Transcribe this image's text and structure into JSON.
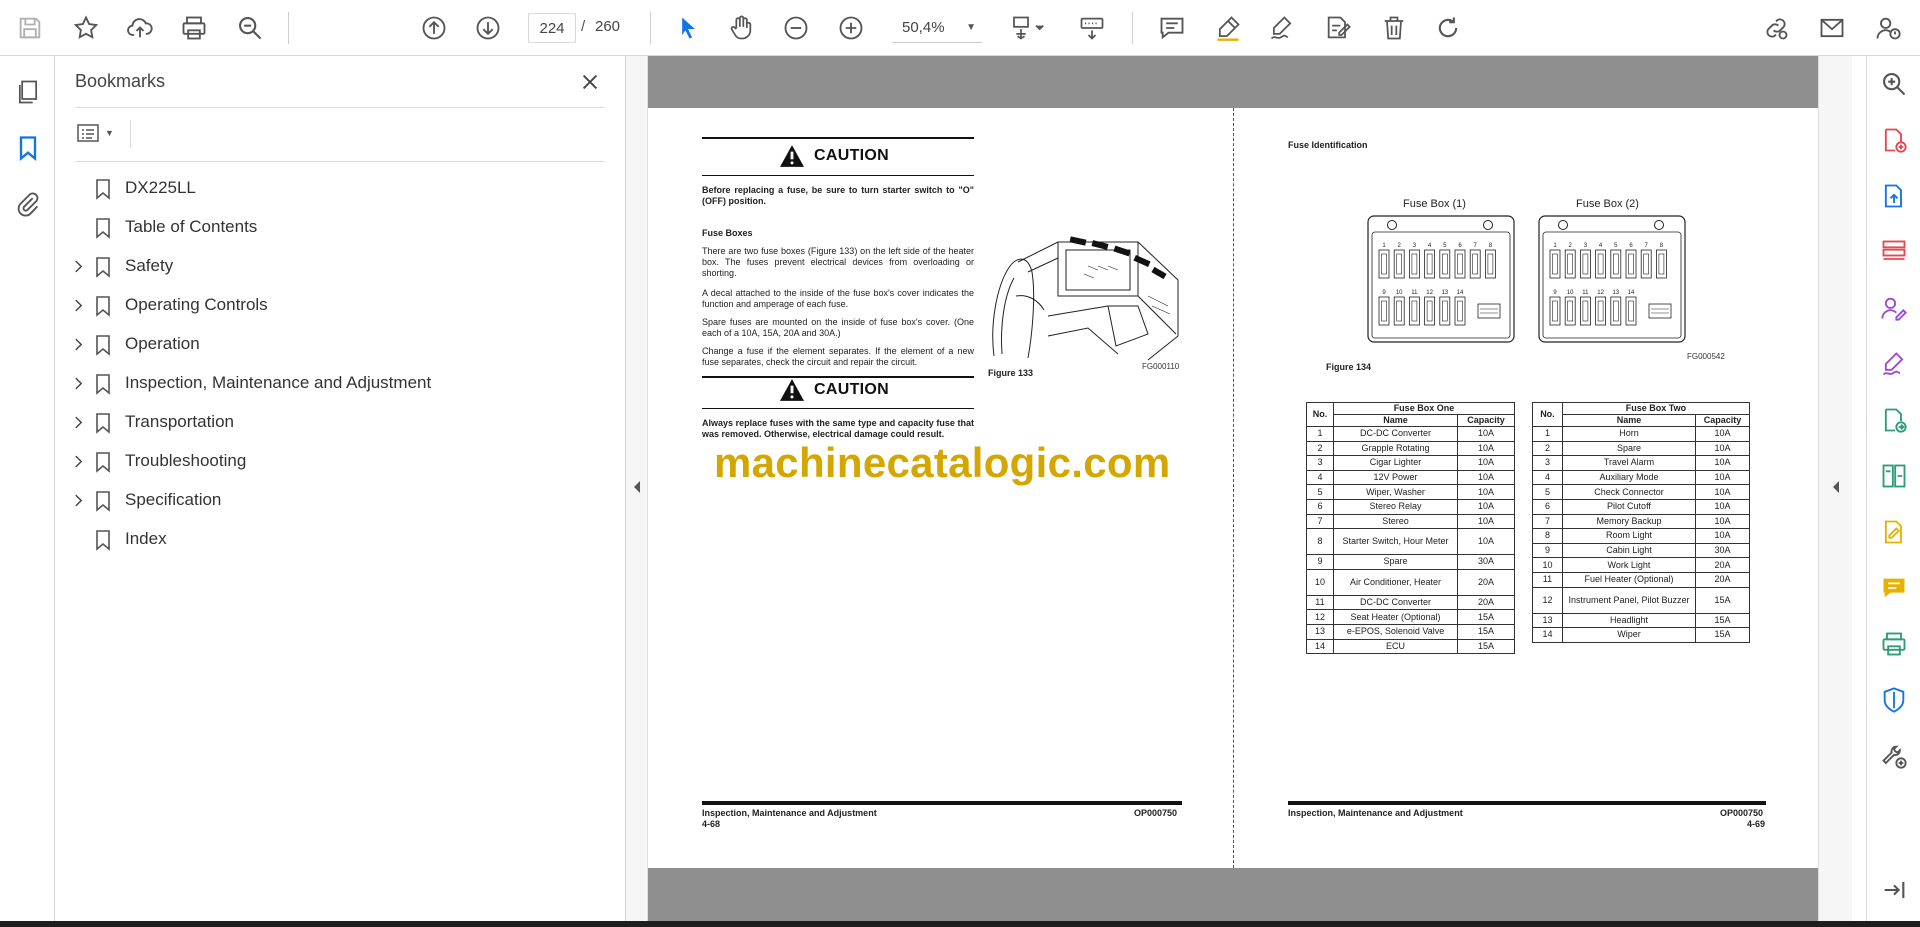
{
  "toolbar": {
    "icons": [
      "save-icon",
      "bookmark-star-icon",
      "upload-cloud-icon",
      "print-icon",
      "zoom-search-icon",
      "page-up-icon",
      "page-down-icon",
      "select-arrow-icon",
      "hand-pan-icon",
      "zoom-out-icon",
      "zoom-in-icon",
      "fit-page-icon",
      "scroll-mode-icon",
      "comment-icon",
      "highlight-pen-icon",
      "sign-icon",
      "fill-sign-icon",
      "delete-icon",
      "redo-icon",
      "share-link-icon",
      "email-icon",
      "account-help-icon"
    ],
    "current_page": "224",
    "page_separator": "/",
    "total_pages": "260",
    "zoom_level": "50,4%"
  },
  "left_rail": {
    "icons": [
      "pages-thumbnails-icon",
      "bookmarks-icon",
      "attachments-icon"
    ]
  },
  "bookmarks": {
    "title": "Bookmarks",
    "items": [
      {
        "label": "DX225LL",
        "expandable": false
      },
      {
        "label": "Table of Contents",
        "expandable": false
      },
      {
        "label": "Safety",
        "expandable": true
      },
      {
        "label": "Operating Controls",
        "expandable": true
      },
      {
        "label": "Operation",
        "expandable": true
      },
      {
        "label": "Inspection, Maintenance and Adjustment",
        "expandable": true
      },
      {
        "label": "Transportation",
        "expandable": true
      },
      {
        "label": "Troubleshooting",
        "expandable": true
      },
      {
        "label": "Specification",
        "expandable": true
      },
      {
        "label": "Index",
        "expandable": false
      }
    ]
  },
  "page_left": {
    "caution1_title": "CAUTION",
    "caution1_text": "Before replacing a fuse, be sure to turn starter switch to \"O\" (OFF) position.",
    "section_heading": "Fuse Boxes",
    "para1": "There are two fuse boxes (Figure 133) on the left side of the heater box. The fuses prevent electrical devices from overloading or shorting.",
    "para2": "A decal attached to the inside of the fuse box's cover indicates the function and amperage of each fuse.",
    "para3": "Spare fuses are mounted on the inside of fuse box's cover. (One each of a 10A, 15A, 20A and 30A.)",
    "para4": "Change a fuse if the element separates. If the element of a new fuse separates, check the circuit and repair the circuit.",
    "caution2_title": "CAUTION",
    "caution2_text": "Always replace fuses with the same type and capacity fuse that was removed. Otherwise, electrical damage could result.",
    "figure_ref": "FG000110",
    "figure_caption": "Figure 133",
    "footer_section": "Inspection, Maintenance and Adjustment",
    "footer_page": "4-68",
    "footer_doc": "OP000750"
  },
  "page_right": {
    "heading": "Fuse Identification",
    "fusebox1_label": "Fuse Box (1)",
    "fusebox2_label": "Fuse Box (2)",
    "fuse_numbers_top": [
      "1",
      "2",
      "3",
      "4",
      "5",
      "6",
      "7",
      "8"
    ],
    "fuse_numbers_bottom": [
      "9",
      "10",
      "11",
      "12",
      "13",
      "14"
    ],
    "figure_ref": "FG000542",
    "figure_caption": "Figure 134",
    "table1": {
      "title": "Fuse Box One",
      "col_no": "No.",
      "col_name": "Name",
      "col_capacity": "Capacity",
      "rows": [
        [
          "1",
          "DC-DC Converter",
          "10A"
        ],
        [
          "2",
          "Grapple Rotating",
          "10A"
        ],
        [
          "3",
          "Cigar Lighter",
          "10A"
        ],
        [
          "4",
          "12V Power",
          "10A"
        ],
        [
          "5",
          "Wiper, Washer",
          "10A"
        ],
        [
          "6",
          "Stereo Relay",
          "10A"
        ],
        [
          "7",
          "Stereo",
          "10A"
        ],
        [
          "8",
          "Starter Switch, Hour Meter",
          "10A"
        ],
        [
          "9",
          "Spare",
          "30A"
        ],
        [
          "10",
          "Air Conditioner, Heater",
          "20A"
        ],
        [
          "11",
          "DC-DC Converter",
          "20A"
        ],
        [
          "12",
          "Seat Heater (Optional)",
          "15A"
        ],
        [
          "13",
          "e-EPOS, Solenoid Valve",
          "15A"
        ],
        [
          "14",
          "ECU",
          "15A"
        ]
      ]
    },
    "table2": {
      "title": "Fuse Box Two",
      "col_no": "No.",
      "col_name": "Name",
      "col_capacity": "Capacity",
      "rows": [
        [
          "1",
          "Horn",
          "10A"
        ],
        [
          "2",
          "Spare",
          "10A"
        ],
        [
          "3",
          "Travel Alarm",
          "10A"
        ],
        [
          "4",
          "Auxiliary Mode",
          "10A"
        ],
        [
          "5",
          "Check Connector",
          "10A"
        ],
        [
          "6",
          "Pilot Cutoff",
          "10A"
        ],
        [
          "7",
          "Memory Backup",
          "10A"
        ],
        [
          "8",
          "Room Light",
          "10A"
        ],
        [
          "9",
          "Cabin Light",
          "30A"
        ],
        [
          "10",
          "Work Light",
          "20A"
        ],
        [
          "11",
          "Fuel Heater (Optional)",
          "20A"
        ],
        [
          "12",
          "Instrument Panel, Pilot Buzzer",
          "15A"
        ],
        [
          "13",
          "Headlight",
          "15A"
        ],
        [
          "14",
          "Wiper",
          "15A"
        ]
      ]
    },
    "footer_section": "Inspection, Maintenance and Adjustment",
    "footer_page": "4-69",
    "footer_doc": "OP000750"
  },
  "watermark": "machinecatalogic.com",
  "right_rail": {
    "icons": [
      "zoom-search-icon",
      "create-pdf-icon",
      "export-pdf-icon",
      "organize-pages-icon",
      "request-signature-icon",
      "fill-sign-icon",
      "send-file-icon",
      "compare-icon",
      "edit-pdf-icon",
      "comment-icon",
      "print-production-icon",
      "protect-icon",
      "more-tools-icon",
      "collapse-rail-icon"
    ]
  },
  "colors": {
    "accent": "#1473e6",
    "tool_red": "#e34850",
    "tool_purple": "#9b4dca",
    "tool_green": "#2d9d78",
    "tool_yellow": "#e8b100",
    "watermark": "#d4a600"
  }
}
